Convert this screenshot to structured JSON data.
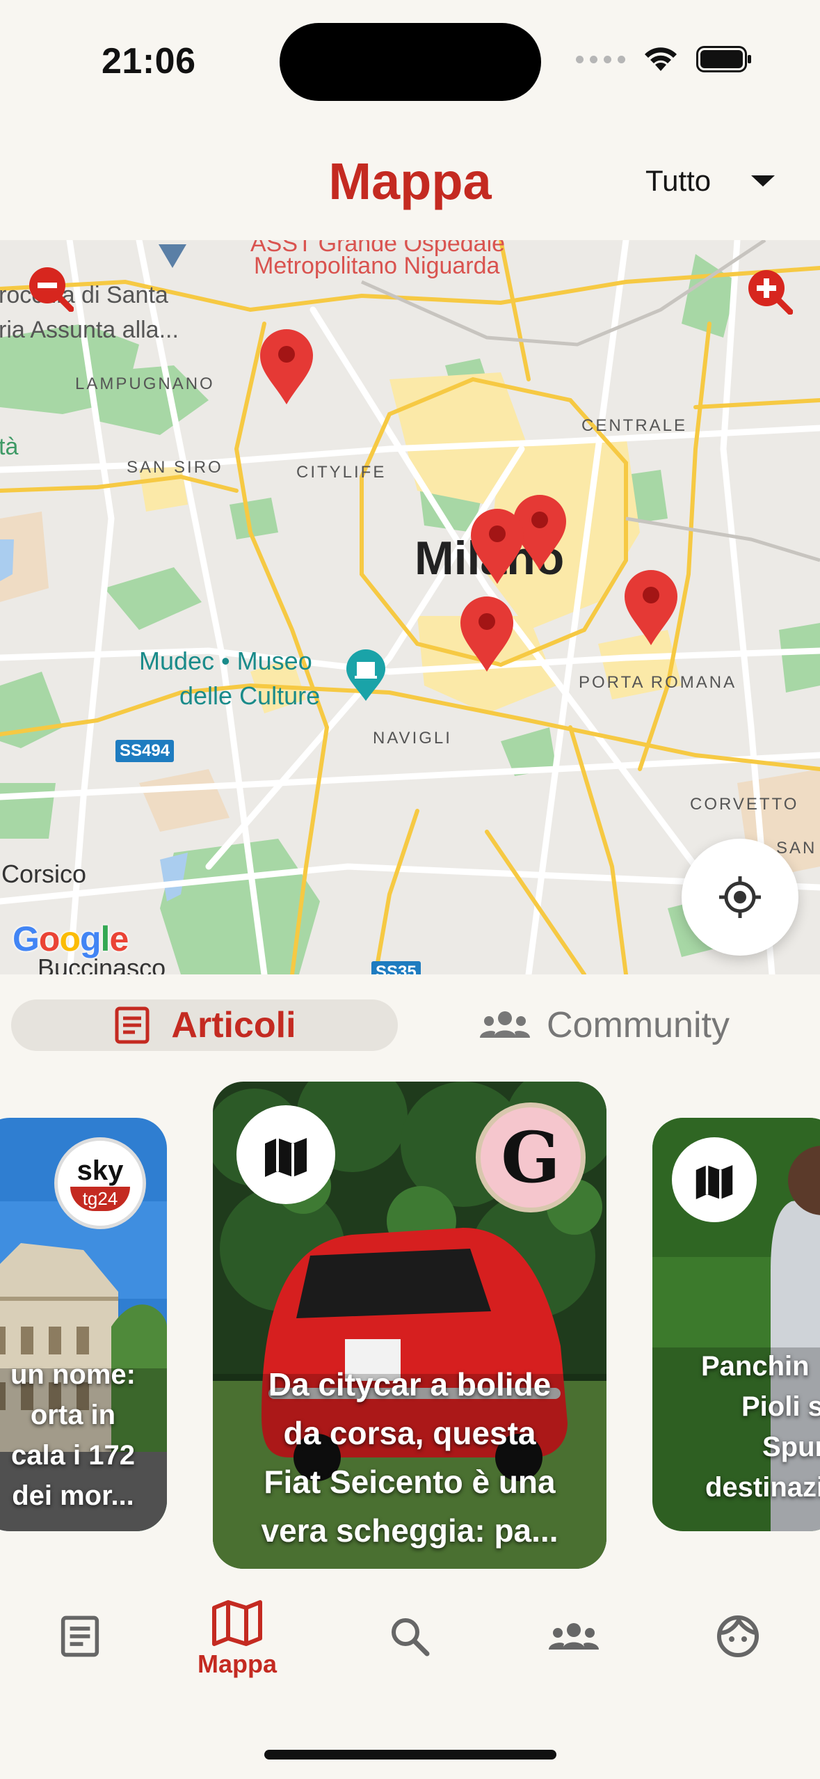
{
  "status_bar": {
    "time": "21:06"
  },
  "header": {
    "title": "Mappa",
    "filter_value": "Tutto"
  },
  "map": {
    "labels": {
      "hospital_1": "ASST Grande Ospedale",
      "hospital_2": "Metropolitano Niguarda",
      "santa_1": "rocchia di Santa",
      "santa_2": "ria Assunta alla...",
      "lampugnano": "LAMPUGNANO",
      "centrale": "CENTRALE",
      "san_siro": "SAN SIRO",
      "citylife": "CITYLIFE",
      "milano": "Milano",
      "mudec_1": "Mudec • Museo",
      "mudec_2": "delle Culture",
      "porta_romana": "PORTA ROMANA",
      "ss494": "SS494",
      "navigli": "NAVIGLI",
      "corvetto": "CORVETTO",
      "corsico": "Corsico",
      "san_edge": "SAN",
      "buccinasco": "Buccinasco",
      "ss35": "SS35",
      "ta_edge": "tà",
      "google": "Google"
    },
    "pin_color": "#e53935",
    "pins": [
      "pin",
      "pin",
      "pin",
      "pin",
      "pin"
    ]
  },
  "tabs": {
    "articles": "Articoli",
    "community": "Community"
  },
  "cards": {
    "left": {
      "source": "sky tg24",
      "source_top": "sky",
      "source_bottom": "tg24",
      "caption_1": "un nome:",
      "caption_2": "orta in",
      "caption_3": "cala i 172",
      "caption_4": "dei mor..."
    },
    "center": {
      "source_letter": "G",
      "caption_1": "Da citycar a bolide",
      "caption_2": "da corsa, questa",
      "caption_3": "Fiat Seicento è una",
      "caption_4": "vera scheggia: pa..."
    },
    "right": {
      "caption_1": "Panchin",
      "caption_2": "Pioli s",
      "caption_3": "Spun",
      "caption_4": "destinazi"
    }
  },
  "nav": {
    "map_label": "Mappa"
  },
  "colors": {
    "accent": "#c42a21",
    "background": "#f8f6f1"
  }
}
